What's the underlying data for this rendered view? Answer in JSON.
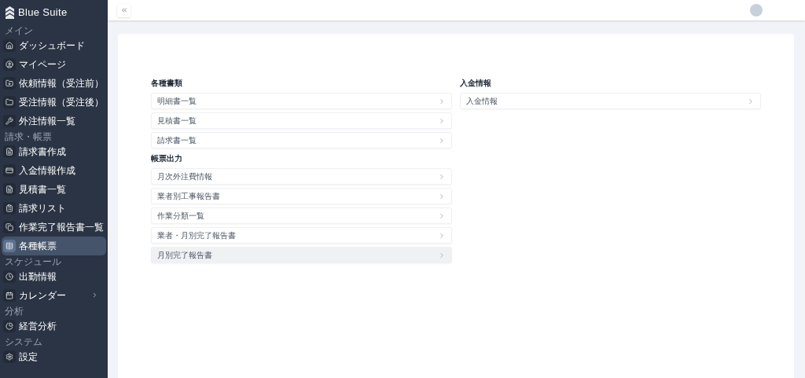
{
  "brand": {
    "name": "Blue Suite"
  },
  "sidebar": {
    "sections": [
      {
        "label": "メイン",
        "items": [
          {
            "label": "ダッシュボード",
            "selected": false,
            "has_submenu": false
          },
          {
            "label": "マイページ",
            "selected": false,
            "has_submenu": false
          },
          {
            "label": "依頼情報（受注前）",
            "selected": false,
            "has_submenu": false
          },
          {
            "label": "受注情報（受注後）",
            "selected": false,
            "has_submenu": false
          },
          {
            "label": "外注情報一覧",
            "selected": false,
            "has_submenu": false
          }
        ]
      },
      {
        "label": "請求・帳票",
        "items": [
          {
            "label": "請求書作成",
            "selected": false,
            "has_submenu": false
          },
          {
            "label": "入金情報作成",
            "selected": false,
            "has_submenu": false
          },
          {
            "label": "見積書一覧",
            "selected": false,
            "has_submenu": false
          },
          {
            "label": "請求リスト",
            "selected": false,
            "has_submenu": false
          },
          {
            "label": "作業完了報告書一覧",
            "selected": false,
            "has_submenu": false
          },
          {
            "label": "各種帳票",
            "selected": true,
            "has_submenu": false
          }
        ]
      },
      {
        "label": "スケジュール",
        "items": [
          {
            "label": "出勤情報",
            "selected": false,
            "has_submenu": false
          },
          {
            "label": "カレンダー",
            "selected": false,
            "has_submenu": true
          }
        ]
      },
      {
        "label": "分析",
        "items": [
          {
            "label": "経営分析",
            "selected": false,
            "has_submenu": false
          }
        ]
      },
      {
        "label": "システム",
        "items": [
          {
            "label": "設定",
            "selected": false,
            "has_submenu": false
          }
        ]
      }
    ]
  },
  "columns": [
    {
      "groups": [
        {
          "title": "各種書類",
          "links": [
            {
              "label": "明細書一覧",
              "highlighted": false
            },
            {
              "label": "見積書一覧",
              "highlighted": false
            },
            {
              "label": "請求書一覧",
              "highlighted": false
            }
          ]
        },
        {
          "title": "帳票出力",
          "links": [
            {
              "label": "月次外注費情報",
              "highlighted": false
            },
            {
              "label": "業者別工事報告書",
              "highlighted": false
            },
            {
              "label": "作業分類一覧",
              "highlighted": false
            },
            {
              "label": "業者・月別完了報告書",
              "highlighted": false
            },
            {
              "label": "月別完了報告書",
              "highlighted": true
            }
          ]
        }
      ]
    },
    {
      "groups": [
        {
          "title": "入金情報",
          "links": [
            {
              "label": "入金情報",
              "highlighted": false
            }
          ]
        }
      ]
    }
  ]
}
